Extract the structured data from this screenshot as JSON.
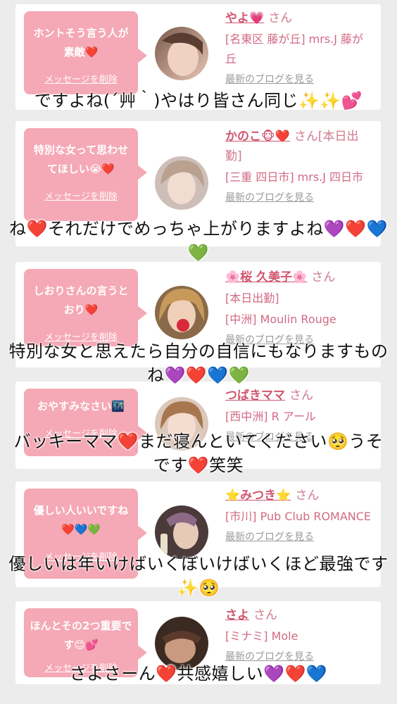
{
  "cards": [
    {
      "message": "ホントそう言う人が素敵❤️",
      "delete_label": "メッセージを削除",
      "name": "やよ💗",
      "honorific": "さん",
      "shop": "[名東区 藤が丘] mrs.J 藤が丘",
      "blog_label": "最新のブログを見る",
      "overlay": "ですよね(´艸｀)やはり皆さん同じ✨✨💕"
    },
    {
      "message": "特別な女って思わせてほしい😭❤️",
      "delete_label": "メッセージを削除",
      "name": "かのこ🐵❤️",
      "honorific": "さん[本日出勤]",
      "shop": "[三重 四日市] mrs.J 四日市",
      "blog_label": "最新のブログを見る",
      "overlay": "ね❤️それだけでめっちゃ上がりますよね💜❤️💙💚"
    },
    {
      "message": "しおりさんの言うとおり❤️",
      "delete_label": "メッセージを削除",
      "name": "🌸桜 久美子🌸",
      "honorific": "さん",
      "status": "[本日出勤]",
      "shop": "[中洲] Moulin Rouge",
      "blog_label": "最新のブログを見る",
      "overlay": "特別な女と思えたら自分の自信にもなりますものね💜❤️💙💚"
    },
    {
      "message": "おやすみなさい🌃",
      "delete_label": "メッセージを削除",
      "name": "つばきママ",
      "honorific": "さん",
      "shop": "[西中洲] R アール",
      "blog_label": "最新のブログを見る",
      "overlay": "バッキーママ❤️まだ寝んといてください🥺うそです❤️笑笑"
    },
    {
      "message": "優しい人いいですね❤️💙💚",
      "delete_label": "メッセージを削除",
      "name": "⭐みつき⭐",
      "honorific": "さん",
      "shop": "[市川] Pub Club ROMANCE",
      "blog_label": "最新のブログを見る",
      "overlay": "優しいは年いけばいくぼいけばいくほど最強です✨🥺"
    },
    {
      "message": "ほんとその2つ重要です😊💕",
      "delete_label": "メッセージを削除",
      "name": "さよ",
      "honorific": "さん",
      "shop": "[ミナミ] Mole",
      "blog_label": "最新のブログを見る",
      "overlay": "さよさーん❤️共感嬉しい💜❤️💙"
    }
  ],
  "colors": {
    "background": "#ececec",
    "card": "#ffffff",
    "bubble": "#f5a8b5",
    "name": "#d0566f",
    "shop": "#d26a84",
    "blog": "#9a9a9a"
  },
  "icons": [
    "avatar-photo"
  ]
}
